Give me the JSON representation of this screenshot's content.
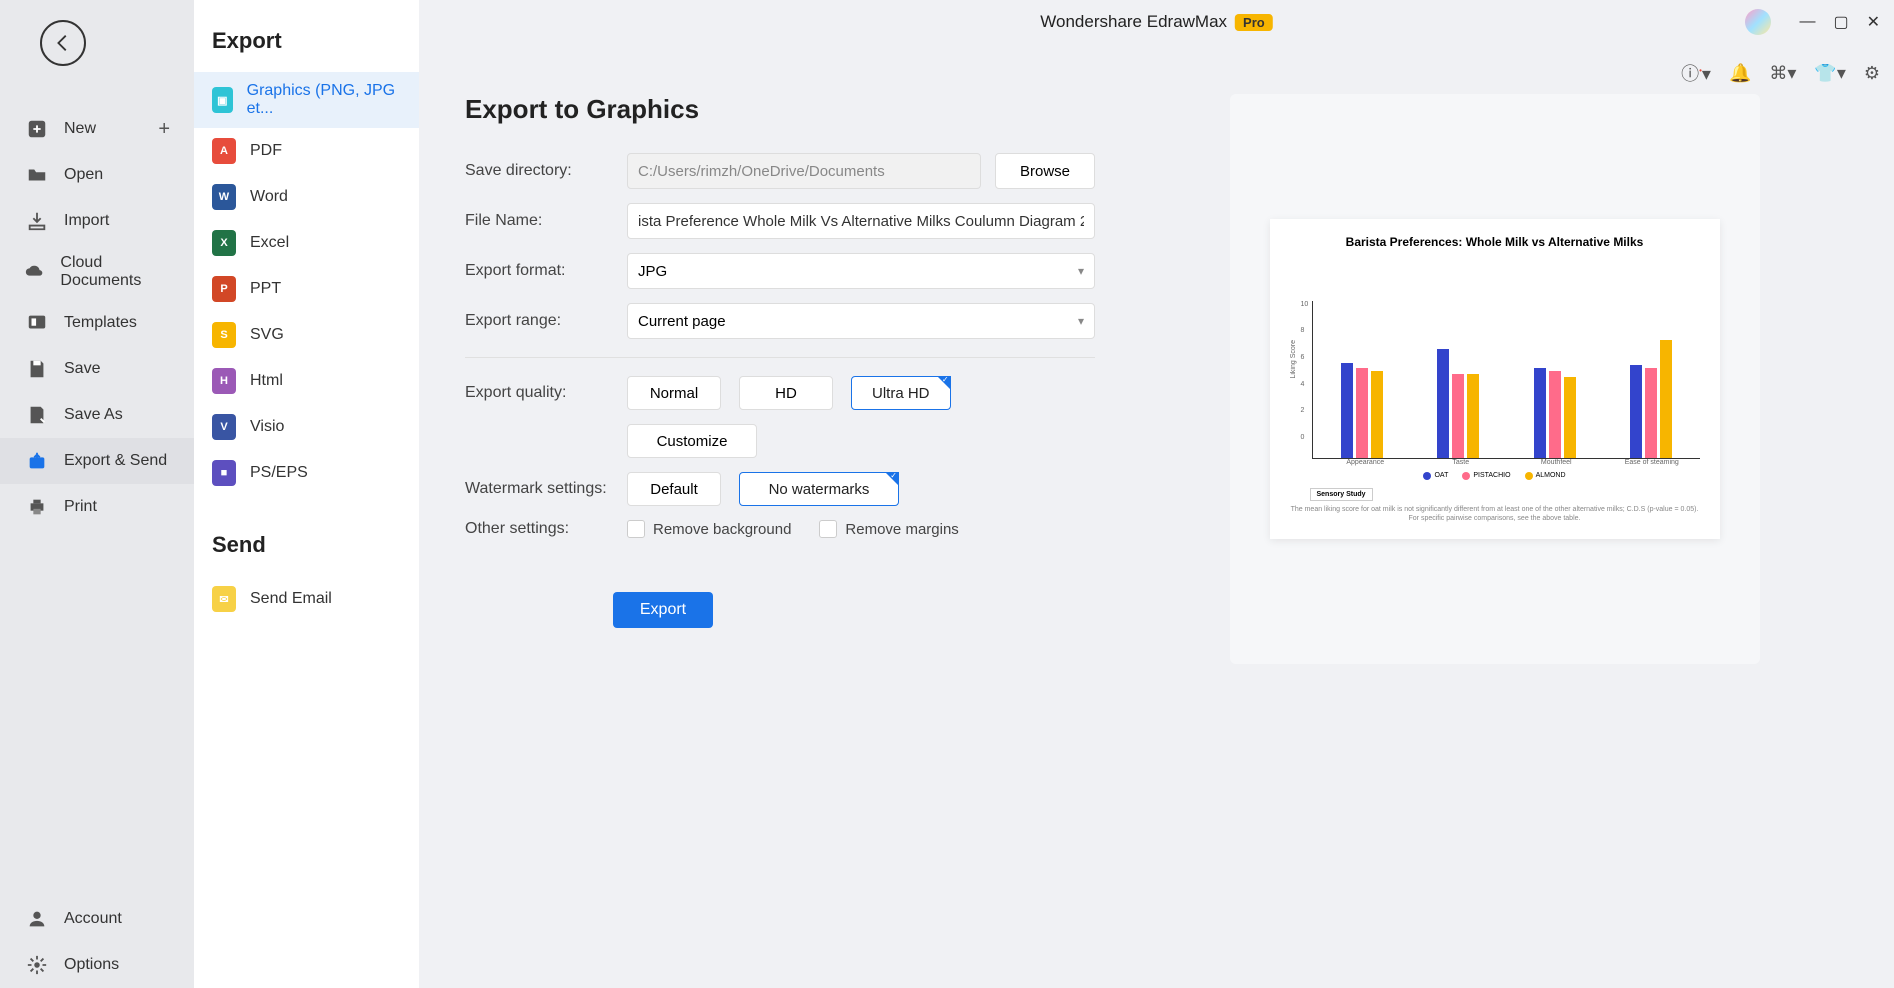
{
  "titlebar": {
    "app": "Wondershare EdrawMax",
    "badge": "Pro"
  },
  "rail": {
    "new": "New",
    "open": "Open",
    "import": "Import",
    "cloud": "Cloud Documents",
    "templates": "Templates",
    "save": "Save",
    "saveas": "Save As",
    "export": "Export & Send",
    "print": "Print",
    "account": "Account",
    "options": "Options"
  },
  "panel": {
    "export_heading": "Export",
    "send_heading": "Send",
    "formats": {
      "graphics": "Graphics (PNG, JPG et...",
      "pdf": "PDF",
      "word": "Word",
      "excel": "Excel",
      "ppt": "PPT",
      "svg": "SVG",
      "html": "Html",
      "visio": "Visio",
      "pseps": "PS/EPS"
    },
    "send_email": "Send Email"
  },
  "form": {
    "title": "Export to Graphics",
    "save_dir_label": "Save directory:",
    "save_dir_value": "C:/Users/rimzh/OneDrive/Documents",
    "browse": "Browse",
    "filename_label": "File Name:",
    "filename_value": "ista Preference Whole Milk Vs Alternative Milks Coulumn Diagram 2",
    "format_label": "Export format:",
    "format_value": "JPG",
    "range_label": "Export range:",
    "range_value": "Current page",
    "quality_label": "Export quality:",
    "quality": {
      "normal": "Normal",
      "hd": "HD",
      "ultra": "Ultra HD",
      "customize": "Customize"
    },
    "watermark_label": "Watermark settings:",
    "watermark": {
      "default": "Default",
      "none": "No watermarks"
    },
    "other_label": "Other settings:",
    "remove_bg": "Remove background",
    "remove_margins": "Remove margins",
    "export_btn": "Export"
  },
  "chart_data": {
    "type": "bar",
    "title": "Barista Preferences: Whole Milk vs Alternative Milks",
    "ylabel": "Liking Score",
    "ylim": [
      0,
      10
    ],
    "categories": [
      "Appearance",
      "Taste",
      "Mouthfeel",
      "Ease of steaming"
    ],
    "series": [
      {
        "name": "OAT",
        "color": "#3344cc",
        "values": [
          6.8,
          7.8,
          6.4,
          6.6
        ]
      },
      {
        "name": "PISTACHIO",
        "color": "#ff6b8a",
        "values": [
          6.4,
          6.0,
          6.2,
          6.4
        ]
      },
      {
        "name": "ALMOND",
        "color": "#f7b500",
        "values": [
          6.2,
          6.0,
          5.8,
          8.4
        ]
      }
    ],
    "sensory_box": "Sensory Study",
    "footnote": "The mean liking score for oat milk is not significantly different from at least one of the other alternative milks; C.D.S (p-value = 0.05). For specific pairwise comparisons, see the above table."
  }
}
